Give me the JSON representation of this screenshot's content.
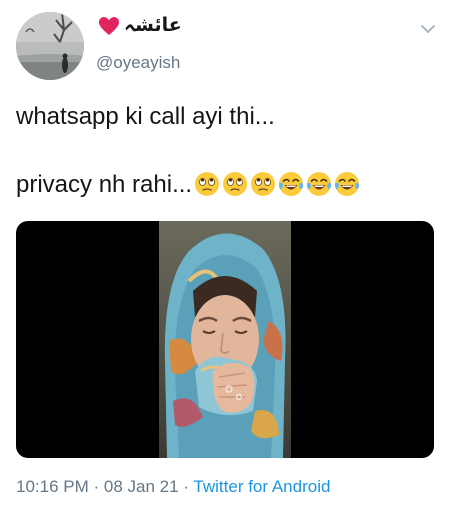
{
  "tweet": {
    "display_name": "عائشہ",
    "handle": "@oyeayish",
    "text_lines": [
      "whatsapp ki call ayi thi...",
      "privacy nh rahi..."
    ],
    "emoji": [
      "eye-roll-face",
      "eye-roll-face",
      "eye-roll-face",
      "tears-of-joy-face",
      "tears-of-joy-face",
      "tears-of-joy-face"
    ],
    "time": "10:16 PM",
    "date": "08 Jan 21",
    "separator": "·",
    "source": "Twitter for Android"
  },
  "colors": {
    "text": "#14171a",
    "secondary": "#657786",
    "link": "#1b95e0",
    "heart": "#e0245e",
    "media_bg": "#000000"
  }
}
